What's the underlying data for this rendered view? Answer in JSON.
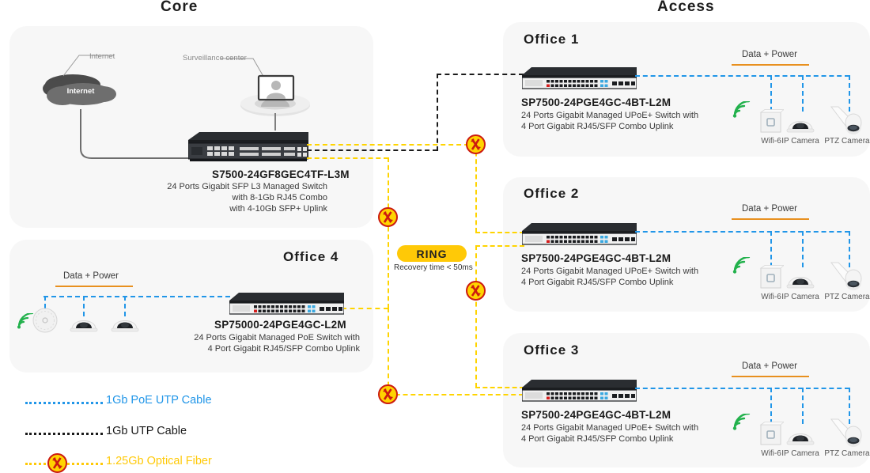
{
  "headers": {
    "core": "Core",
    "access": "Access"
  },
  "core": {
    "internet_label": "Internet",
    "cloud_text": "Internet",
    "surveillance_label": "Surveillance center",
    "switch": {
      "model": "S7500-24GF8GEC4TF-L3M",
      "desc_line1": "24 Ports Gigabit SFP L3  Managed Switch",
      "desc_line2": "with 8-1Gb RJ45 Combo",
      "desc_line3": "with 4-10Gb SFP+ Uplink"
    }
  },
  "ring": {
    "badge": "RING",
    "sub": "Recovery time < 50ms"
  },
  "office4": {
    "title": "Office  4",
    "data_power": "Data + Power",
    "switch": {
      "model": "SP75000-24PGE4GC-L2M",
      "desc_line1": "24 Ports Gigabit Managed PoE Switch with",
      "desc_line2": "4 Port Gigabit RJ45/SFP Combo Uplink"
    },
    "devices": [
      {
        "name": "wifi-ap",
        "label": ""
      },
      {
        "name": "dome-camera-1",
        "label": ""
      },
      {
        "name": "dome-camera-2",
        "label": ""
      }
    ]
  },
  "offices": [
    {
      "title": "Office  1",
      "data_power": "Data + Power",
      "switch": {
        "model": "SP7500-24PGE4GC-4BT-L2M",
        "desc_line1": "24 Ports Gigabit Managed UPoE+ Switch with",
        "desc_line2": "4 Port Gigabit RJ45/SFP Combo Uplink"
      },
      "devices": [
        {
          "name": "wifi-6-ap",
          "label": "Wifi-6"
        },
        {
          "name": "ip-camera",
          "label": "IP Camera"
        },
        {
          "name": "ptz-camera",
          "label": "PTZ Camera"
        }
      ]
    },
    {
      "title": "Office  2",
      "data_power": "Data + Power",
      "switch": {
        "model": "SP7500-24PGE4GC-4BT-L2M",
        "desc_line1": "24 Ports Gigabit Managed UPoE+ Switch with",
        "desc_line2": "4 Port Gigabit RJ45/SFP Combo Uplink"
      },
      "devices": [
        {
          "name": "wifi-6-ap",
          "label": "Wifi-6"
        },
        {
          "name": "ip-camera",
          "label": "IP Camera"
        },
        {
          "name": "ptz-camera",
          "label": "PTZ Camera"
        }
      ]
    },
    {
      "title": "Office  3",
      "data_power": "Data + Power",
      "switch": {
        "model": "SP7500-24PGE4GC-4BT-L2M",
        "desc_line1": "24 Ports Gigabit Managed UPoE+ Switch with",
        "desc_line2": "4 Port Gigabit RJ45/SFP Combo Uplink"
      },
      "devices": [
        {
          "name": "wifi-6-ap",
          "label": "Wifi-6"
        },
        {
          "name": "ip-camera",
          "label": "IP Camera"
        },
        {
          "name": "ptz-camera",
          "label": "PTZ Camera"
        }
      ]
    }
  ],
  "legend": [
    {
      "label": "1Gb PoE UTP Cable",
      "color": "#2196e8",
      "style": "dotted"
    },
    {
      "label": "1Gb UTP Cable",
      "color": "#1b1b1b",
      "style": "dotted"
    },
    {
      "label": "1.25Gb Optical Fiber",
      "color": "#ffc907",
      "style": "dotted-with-icon"
    }
  ],
  "colors": {
    "poe_blue": "#2196e8",
    "utp_black": "#1b1b1b",
    "fiber_yellow": "#ffd400",
    "accent_orange": "#e8901f",
    "ring_badge": "#ffc907",
    "card_bg": "#f7f7f7"
  }
}
